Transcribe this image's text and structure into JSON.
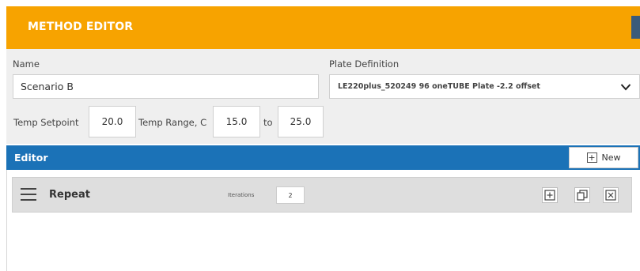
{
  "header": {
    "title": "METHOD EDITOR"
  },
  "form": {
    "name_label": "Name",
    "name_value": "Scenario B",
    "plate_label": "Plate Definition",
    "plate_value": "LE220plus_520249 96 oneTUBE Plate -2.2 offset",
    "temp_setpoint_label": "Temp Setpoint",
    "temp_setpoint_value": "20.0",
    "temp_range_label": "Temp Range, C",
    "temp_range_min": "15.0",
    "to_label": "to",
    "temp_range_max": "25.0"
  },
  "editor": {
    "title": "Editor",
    "new_label": "New",
    "repeat_label": "Repeat",
    "iterations_label": "Iterations",
    "iterations_value": "2"
  },
  "icons": {
    "dropdown": "chevron-down-icon",
    "new": "plus-square-icon",
    "menu": "hamburger-icon",
    "add": "plus-square-icon",
    "copy": "copy-icon",
    "close": "close-square-icon"
  },
  "colors": {
    "header": "#f7a300",
    "editor_bar": "#1b72b7",
    "form_panel": "#efefef"
  }
}
